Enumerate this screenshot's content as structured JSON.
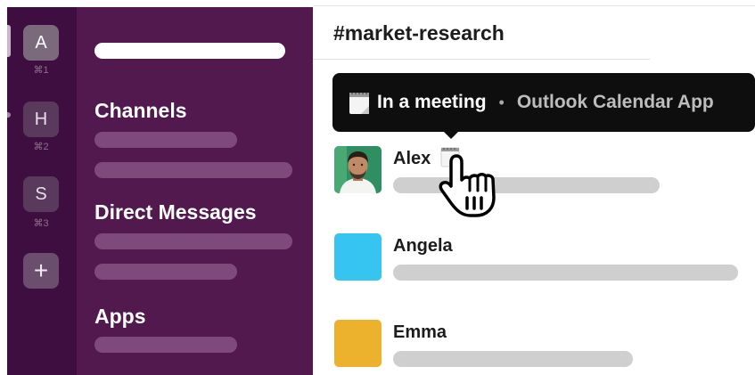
{
  "workspaces": [
    {
      "letter": "A",
      "shortcut": "⌘1"
    },
    {
      "letter": "H",
      "shortcut": "⌘2"
    },
    {
      "letter": "S",
      "shortcut": "⌘3"
    }
  ],
  "add_workspace": "+",
  "sidebar": {
    "channels_title": "Channels",
    "dm_title": "Direct Messages",
    "apps_title": "Apps"
  },
  "channel": {
    "name": "#market-research"
  },
  "tooltip": {
    "status": "In a meeting",
    "separator": "•",
    "app": "Outlook Calendar App"
  },
  "members": [
    {
      "name": "Alex",
      "status_icon": "calendar-icon"
    },
    {
      "name": "Angela",
      "color": "#36c5f0"
    },
    {
      "name": "Emma",
      "color": "#ecb22e"
    }
  ],
  "colors": {
    "rail": "#3f0e40",
    "sidebar": "#52194f",
    "tooltip": "#0e0e0e"
  }
}
